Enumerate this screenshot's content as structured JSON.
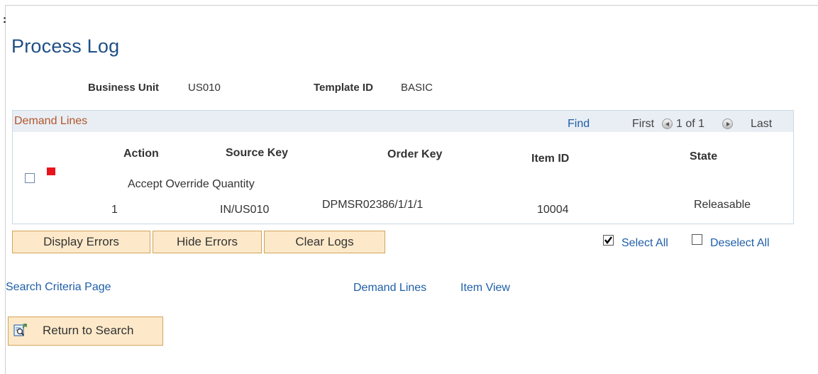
{
  "page": {
    "corner_mark": ":",
    "title": "Process Log"
  },
  "header": {
    "business_unit_label": "Business Unit",
    "business_unit_value": "US010",
    "template_id_label": "Template ID",
    "template_id_value": "BASIC"
  },
  "grid": {
    "title": "Demand Lines",
    "find_label": "Find",
    "first_label": "First",
    "page_count": "1 of 1",
    "last_label": "Last",
    "columns": {
      "action": "Action",
      "source_key": "Source Key",
      "order_key": "Order Key",
      "item_id": "Item ID",
      "state": "State"
    },
    "rows": [
      {
        "message": "Accept Override Quantity",
        "action": "1",
        "source_key": "IN/US010",
        "order_key": "DPMSR02386/1/1/1",
        "item_id": "10004",
        "state": "Releasable",
        "checked": false,
        "error_flag_color": "#e8141c"
      }
    ]
  },
  "toolbar": {
    "display_errors": "Display Errors",
    "hide_errors": "Hide Errors",
    "clear_logs": "Clear Logs",
    "select_all": "Select All",
    "deselect_all": "Deselect All"
  },
  "links": {
    "search_criteria": "Search Criteria Page",
    "demand_lines": "Demand Lines",
    "item_view": "Item View"
  },
  "return_button": {
    "label": "Return to Search",
    "icon": "search-return-icon"
  },
  "colors": {
    "title": "#1f4f85",
    "link": "#1f5fa8",
    "grid_title": "#b3562a",
    "button_bg": "#fde9c9",
    "button_border": "#d1a45a"
  }
}
